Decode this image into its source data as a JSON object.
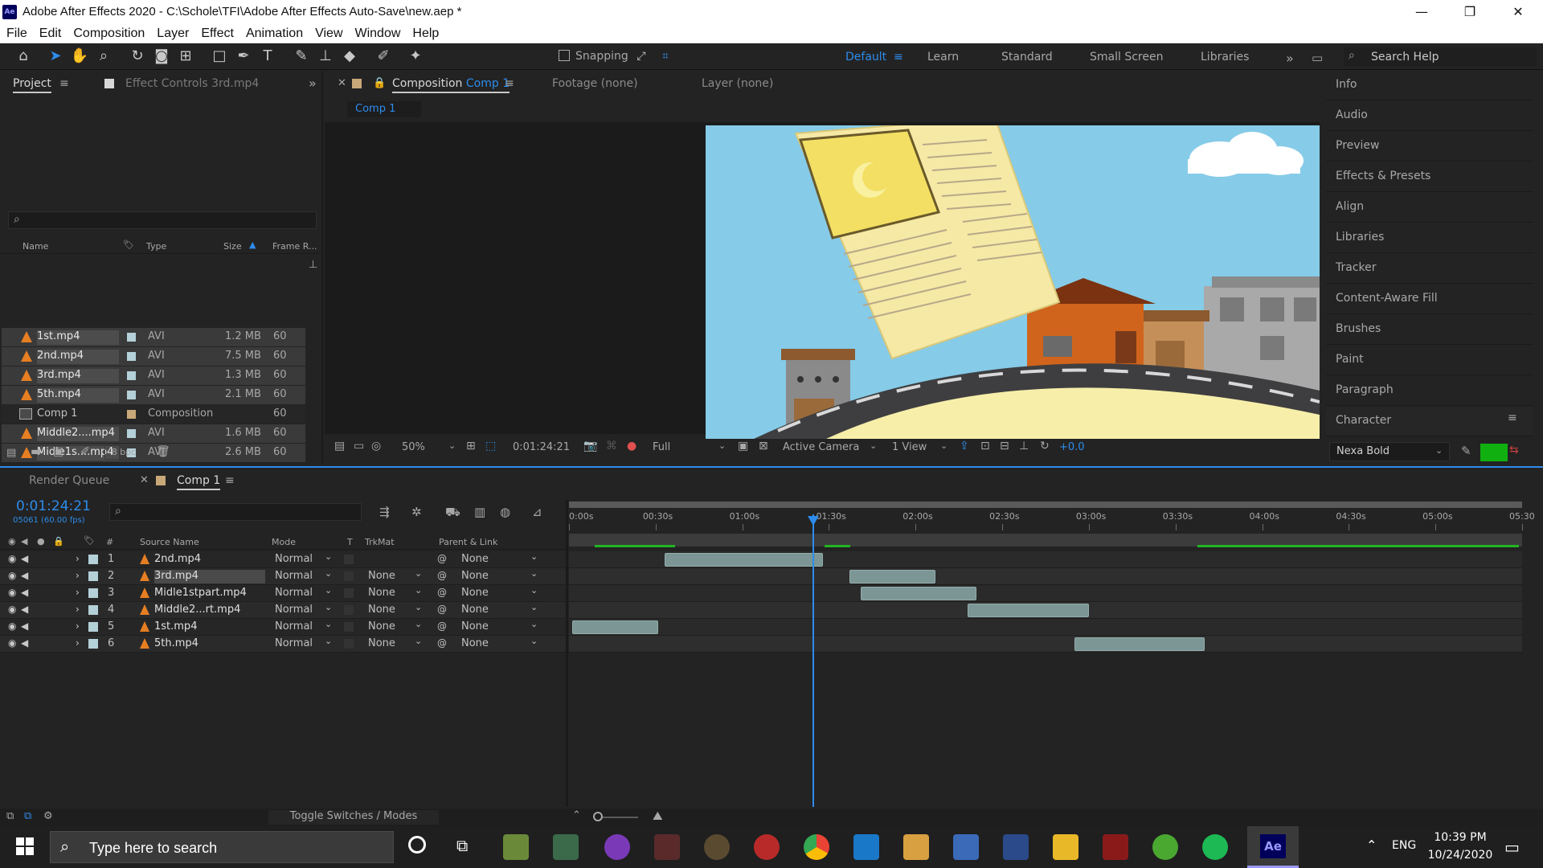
{
  "window": {
    "title": "Adobe After Effects 2020 - C:\\Schole\\TFI\\Adobe After Effects Auto-Save\\new.aep *",
    "app_badge": "Ae",
    "minimize": "—",
    "restore": "❐",
    "close": "✕"
  },
  "menu": [
    "File",
    "Edit",
    "Composition",
    "Layer",
    "Effect",
    "Animation",
    "View",
    "Window",
    "Help"
  ],
  "toolbar": {
    "snapping_label": "Snapping",
    "workspaces": [
      "Default",
      "Learn",
      "Standard",
      "Small Screen",
      "Libraries"
    ],
    "active_workspace": "Default",
    "more": "»",
    "search_placeholder": "Search Help"
  },
  "project_panel": {
    "tab_project": "Project",
    "tab_effect_controls": "Effect Controls 3rd.mp4",
    "columns": {
      "name": "Name",
      "type": "Type",
      "size": "Size",
      "frame_rate": "Frame R..."
    },
    "items": [
      {
        "name": "1st.mp4",
        "type": "AVI",
        "size": "1.2 MB",
        "fr": "60",
        "kind": "video",
        "color": "#b4d0d8"
      },
      {
        "name": "2nd.mp4",
        "type": "AVI",
        "size": "7.5 MB",
        "fr": "60",
        "kind": "video",
        "color": "#b4d0d8"
      },
      {
        "name": "3rd.mp4",
        "type": "AVI",
        "size": "1.3 MB",
        "fr": "60",
        "kind": "video",
        "color": "#b4d0d8"
      },
      {
        "name": "5th.mp4",
        "type": "AVI",
        "size": "2.1 MB",
        "fr": "60",
        "kind": "video",
        "color": "#b4d0d8"
      },
      {
        "name": "Comp 1",
        "type": "Composition",
        "size": "",
        "fr": "60",
        "kind": "comp",
        "color": "#c8a878"
      },
      {
        "name": "Middle2....mp4",
        "type": "AVI",
        "size": "1.6 MB",
        "fr": "60",
        "kind": "video",
        "color": "#b4d0d8"
      },
      {
        "name": "Midle1s....mp4",
        "type": "AVI",
        "size": "2.6 MB",
        "fr": "60",
        "kind": "video",
        "color": "#b4d0d8"
      }
    ],
    "bpc": "8 bpc"
  },
  "comp_panel": {
    "tab_composition_prefix": "Composition",
    "tab_composition_name": "Comp 1",
    "tab_footage": "Footage (none)",
    "tab_layer": "Layer (none)",
    "subtab": "Comp 1",
    "zoom": "50%",
    "timecode": "0:01:24:21",
    "resolution": "Full",
    "camera": "Active Camera",
    "views": "1 View",
    "exposure": "+0.0"
  },
  "right_panel": {
    "items": [
      "Info",
      "Audio",
      "Preview",
      "Effects & Presets",
      "Align",
      "Libraries",
      "Tracker",
      "Content-Aware Fill",
      "Brushes",
      "Paint",
      "Paragraph",
      "Character"
    ],
    "font": "Nexa Bold",
    "fill_color": "#10b010"
  },
  "timeline": {
    "tab_render_queue": "Render Queue",
    "tab_comp": "Comp 1",
    "timecode": "0:01:24:21",
    "frames_info": "05061 (60.00 fps)",
    "columns": {
      "source": "Source Name",
      "mode": "Mode",
      "t": "T",
      "trkmat": "TrkMat",
      "parent": "Parent & Link"
    },
    "ruler_labels": [
      "0:00s",
      "00:30s",
      "01:00s",
      "01:30s",
      "02:00s",
      "02:30s",
      "03:00s",
      "03:30s",
      "04:00s",
      "04:30s",
      "05:00s",
      "05:30"
    ],
    "duration_seconds": 330,
    "current_time_seconds": 84.35,
    "layers": [
      {
        "num": "1",
        "name": "2nd.mp4",
        "mode": "Normal",
        "trkmat": "",
        "parent": "None",
        "in": 33,
        "out": 88
      },
      {
        "num": "2",
        "name": "3rd.mp4",
        "mode": "Normal",
        "trkmat": "None",
        "parent": "None",
        "in": 97,
        "out": 127
      },
      {
        "num": "3",
        "name": "Midle1stpart.mp4",
        "mode": "Normal",
        "trkmat": "None",
        "parent": "None",
        "in": 101,
        "out": 141
      },
      {
        "num": "4",
        "name": "Middle2...rt.mp4",
        "mode": "Normal",
        "trkmat": "None",
        "parent": "None",
        "in": 138,
        "out": 180
      },
      {
        "num": "5",
        "name": "1st.mp4",
        "mode": "Normal",
        "trkmat": "None",
        "parent": "None",
        "in": 1,
        "out": 31
      },
      {
        "num": "6",
        "name": "5th.mp4",
        "mode": "Normal",
        "trkmat": "None",
        "parent": "None",
        "in": 175,
        "out": 220
      }
    ],
    "toggle_label": "Toggle Switches / Modes"
  },
  "taskbar": {
    "search_placeholder": "Type here to search",
    "lang": "ENG",
    "time": "10:39 PM",
    "date": "10/24/2020"
  }
}
